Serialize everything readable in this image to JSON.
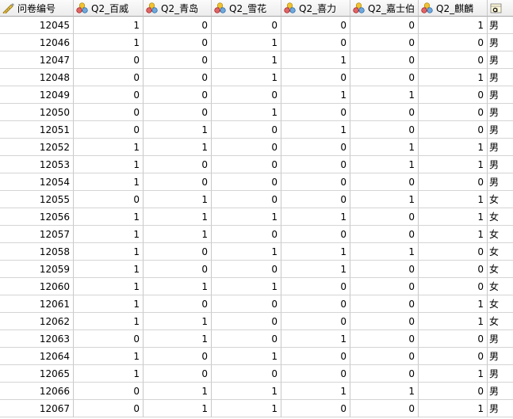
{
  "columns": [
    {
      "label": "问卷编号",
      "icon": "ruler-pencil-icon",
      "align": "right"
    },
    {
      "label": "Q2_百威",
      "icon": "nominal-variable-icon",
      "align": "right"
    },
    {
      "label": "Q2_青岛",
      "icon": "nominal-variable-icon",
      "align": "right"
    },
    {
      "label": "Q2_雪花",
      "icon": "nominal-variable-icon",
      "align": "right"
    },
    {
      "label": "Q2_喜力",
      "icon": "nominal-variable-icon",
      "align": "right"
    },
    {
      "label": "Q2_嘉士伯",
      "icon": "nominal-variable-icon",
      "align": "right"
    },
    {
      "label": "Q2_麒麟",
      "icon": "nominal-variable-icon",
      "align": "right"
    },
    {
      "label": "",
      "icon": "string-variable-icon",
      "align": "left"
    }
  ],
  "rows": [
    [
      "12045",
      "1",
      "0",
      "0",
      "0",
      "0",
      "1",
      "男"
    ],
    [
      "12046",
      "1",
      "0",
      "1",
      "0",
      "0",
      "0",
      "男"
    ],
    [
      "12047",
      "0",
      "0",
      "1",
      "1",
      "0",
      "0",
      "男"
    ],
    [
      "12048",
      "0",
      "0",
      "1",
      "0",
      "0",
      "1",
      "男"
    ],
    [
      "12049",
      "0",
      "0",
      "0",
      "1",
      "1",
      "0",
      "男"
    ],
    [
      "12050",
      "0",
      "0",
      "1",
      "0",
      "0",
      "0",
      "男"
    ],
    [
      "12051",
      "0",
      "1",
      "0",
      "1",
      "0",
      "0",
      "男"
    ],
    [
      "12052",
      "1",
      "1",
      "0",
      "0",
      "1",
      "1",
      "男"
    ],
    [
      "12053",
      "1",
      "0",
      "0",
      "0",
      "1",
      "1",
      "男"
    ],
    [
      "12054",
      "1",
      "0",
      "0",
      "0",
      "0",
      "0",
      "男"
    ],
    [
      "12055",
      "0",
      "1",
      "0",
      "0",
      "1",
      "1",
      "女"
    ],
    [
      "12056",
      "1",
      "1",
      "1",
      "1",
      "0",
      "1",
      "女"
    ],
    [
      "12057",
      "1",
      "1",
      "0",
      "0",
      "0",
      "1",
      "女"
    ],
    [
      "12058",
      "1",
      "0",
      "1",
      "1",
      "1",
      "0",
      "女"
    ],
    [
      "12059",
      "1",
      "0",
      "0",
      "1",
      "0",
      "0",
      "女"
    ],
    [
      "12060",
      "1",
      "1",
      "1",
      "0",
      "0",
      "0",
      "女"
    ],
    [
      "12061",
      "1",
      "0",
      "0",
      "0",
      "0",
      "1",
      "女"
    ],
    [
      "12062",
      "1",
      "1",
      "0",
      "0",
      "0",
      "1",
      "女"
    ],
    [
      "12063",
      "0",
      "1",
      "0",
      "1",
      "0",
      "0",
      "男"
    ],
    [
      "12064",
      "1",
      "0",
      "1",
      "0",
      "0",
      "0",
      "男"
    ],
    [
      "12065",
      "1",
      "0",
      "0",
      "0",
      "0",
      "1",
      "男"
    ],
    [
      "12066",
      "0",
      "1",
      "1",
      "1",
      "1",
      "0",
      "男"
    ],
    [
      "12067",
      "0",
      "1",
      "1",
      "0",
      "0",
      "1",
      "男"
    ]
  ]
}
